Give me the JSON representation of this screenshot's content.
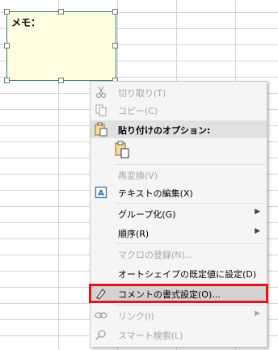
{
  "comment": {
    "text": "メモ："
  },
  "menu": {
    "items": [
      {
        "label": "切り取り(T)",
        "icon": "scissors-icon",
        "disabled": true
      },
      {
        "label": "コピー(C)",
        "icon": "copy-icon",
        "disabled": true
      },
      {
        "label": "貼り付けのオプション:",
        "icon": "clipboard-icon",
        "disabled": false
      },
      {
        "label": "再変換(V)",
        "disabled": true
      },
      {
        "label": "テキストの編集(X)",
        "icon": "edit-text-icon",
        "disabled": false
      },
      {
        "label": "グループ化(G)",
        "disabled": false,
        "submenu": true
      },
      {
        "label": "順序(R)",
        "disabled": false,
        "submenu": true
      },
      {
        "label": "マクロの登録(N)...",
        "disabled": true
      },
      {
        "label": "オートシェイプの既定値に設定(D)",
        "disabled": false
      },
      {
        "label": "コメントの書式設定(O)...",
        "icon": "format-comment-icon",
        "disabled": false,
        "highlighted": true
      },
      {
        "label": "リンク(I)",
        "icon": "link-icon",
        "disabled": true,
        "submenu": true
      },
      {
        "label": "スマート検索(L)",
        "icon": "search-icon",
        "disabled": true
      }
    ]
  },
  "colors": {
    "comment_fill": "#ffffe1",
    "comment_border": "#2e7d6b",
    "highlight_border": "#e0141e",
    "disabled_text": "#a6a6a6"
  }
}
